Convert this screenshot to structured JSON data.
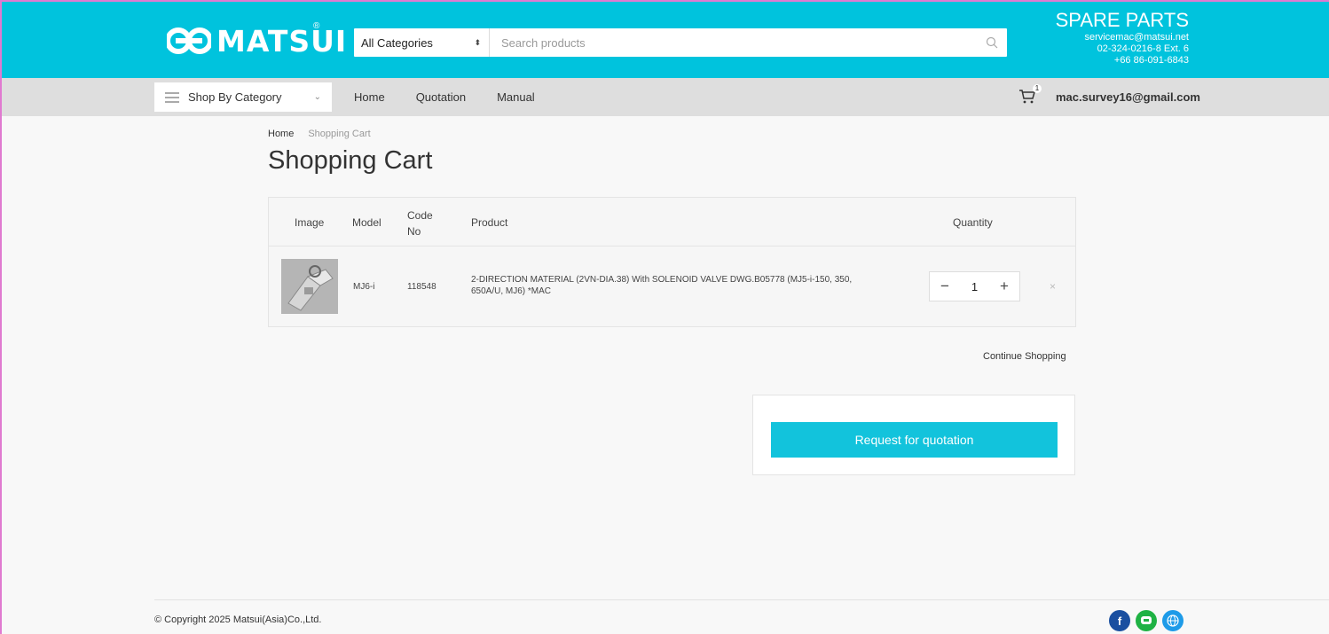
{
  "header": {
    "brand": "MATSUI",
    "brand_reg": "®",
    "search": {
      "category_selected": "All Categories",
      "placeholder": "Search products"
    },
    "spare_parts": {
      "title": "SPARE PARTS",
      "email": "servicemac@matsui.net",
      "phone1": "02-324-0216-8 Ext. 6",
      "phone2": "+66 86-091-6843"
    }
  },
  "nav": {
    "shop_by_category": "Shop By Category",
    "links": [
      "Home",
      "Quotation",
      "Manual"
    ],
    "cart_count": "1",
    "user_email": "mac.survey16@gmail.com"
  },
  "breadcrumb": {
    "home": "Home",
    "current": "Shopping Cart"
  },
  "page_title": "Shopping Cart",
  "cart": {
    "columns": {
      "image": "Image",
      "model": "Model",
      "code_line1": "Code",
      "code_line2": "No",
      "product": "Product",
      "quantity": "Quantity"
    },
    "items": [
      {
        "model": "MJ6-i",
        "code": "118548",
        "product_line1": "2-DIRECTION MATERIAL (2VN-DIA.38) With SOLENOID VALVE DWG.B05778 (MJ5-i-150, 350,",
        "product_line2": "650A/U, MJ6) *MAC",
        "quantity": "1",
        "minus": "−",
        "plus": "+",
        "remove": "×"
      }
    ],
    "continue_shopping": "Continue Shopping",
    "request_quotation": "Request for quotation"
  },
  "footer": {
    "copyright": "© Copyright 2025 Matsui(Asia)Co.,Ltd.",
    "socials": [
      "facebook-icon",
      "line-icon",
      "globe-icon"
    ]
  },
  "colors": {
    "brand": "#00c3dd",
    "button": "#12c3dc",
    "facebook": "#1a4fa0",
    "line": "#1fb244",
    "globe": "#1e9be8"
  }
}
